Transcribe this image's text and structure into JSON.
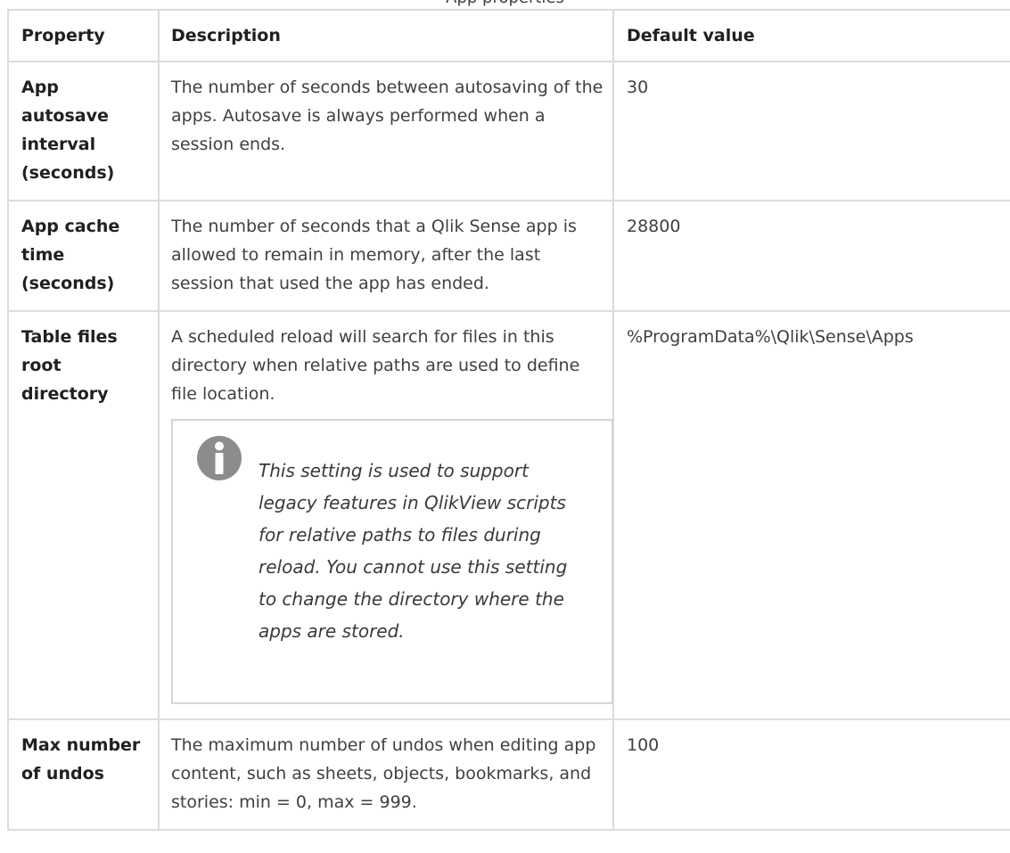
{
  "caption": "App properties",
  "columns": [
    "Property",
    "Description",
    "Default value"
  ],
  "rows": [
    {
      "property": "App autosave interval (seconds)",
      "description": "The number of seconds between autosaving of the apps. Autosave is always performed when a session ends.",
      "default": "30"
    },
    {
      "property": "App cache time (seconds)",
      "description": "The number of seconds that a Qlik Sense app is allowed to remain in memory, after the last session that used the app has ended.",
      "default": "28800"
    },
    {
      "property": "Table files root directory",
      "description": "A scheduled reload will search for files in this directory when relative paths are used to define file location.",
      "note": "This setting is used to support legacy features in QlikView scripts for relative paths to files during reload. You cannot use this setting to change the directory where the apps are stored.",
      "default": "%ProgramData%\\Qlik\\Sense\\Apps"
    },
    {
      "property": "Max number of undos",
      "description": "The maximum number of undos when editing app content, such as sheets, objects, bookmarks, and stories: min = 0, max = 999.",
      "default": "100"
    }
  ],
  "icons": {
    "note_icon": "info-icon",
    "note_icon_color": "#8c8c8c"
  }
}
